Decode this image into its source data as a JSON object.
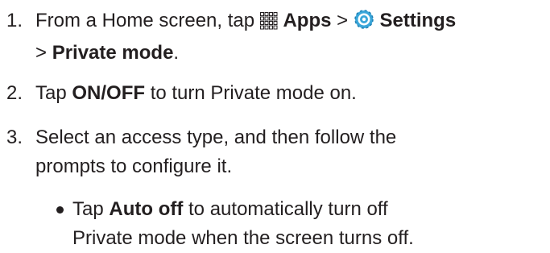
{
  "steps": [
    {
      "number": "1.",
      "text_a": "From a Home screen, tap",
      "apps_label": "Apps",
      "sep1": ">",
      "settings_label": "Settings",
      "sep2": ">",
      "private_label": "Private mode",
      "end": "."
    },
    {
      "number": "2.",
      "text_a": "Tap",
      "onoff_label": "ON/OFF",
      "text_b": "to turn Private mode on."
    },
    {
      "number": "3.",
      "line1": "Select an access type, and then follow the",
      "line2": "prompts to configure it."
    }
  ],
  "bullet": {
    "text_a": "Tap",
    "auto_label": "Auto off",
    "text_b": "to automatically turn off",
    "line2": "Private mode when the screen turns off."
  },
  "icons": {
    "apps": "apps-grid-icon",
    "settings": "settings-gear-icon"
  },
  "colors": {
    "text": "#231f20",
    "settings_icon": "#3aa6d9"
  }
}
